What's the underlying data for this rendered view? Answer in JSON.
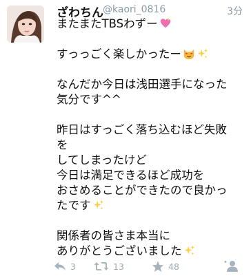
{
  "user": {
    "display_name": "ざわちん",
    "handle": "@kaori_0816",
    "time": "3分"
  },
  "tweet": {
    "lines": [
      "またまたTBSわずー",
      "",
      "すっっごく楽しかったー",
      "",
      "なんだか今日は浅田選手になった",
      "気分です^^",
      "",
      "昨日はすっごく落ち込むほど失敗",
      "を",
      "してしまったけど",
      "今日は満足できるほど成功を",
      "おさめることができたので良かっ",
      "たです",
      "",
      "関係者の皆さま本当に",
      "ありがとうございました"
    ]
  },
  "actions": {
    "reply_count": "3",
    "retweet_count": "13",
    "favorite_count": "48"
  },
  "icons": {
    "reply": "reply-icon",
    "retweet": "retweet-icon",
    "favorite": "star-icon",
    "more": "follow-icon",
    "heart_emoji": "sparkling-heart-emoji",
    "cat_emoji": "heart-eyes-cat-emoji",
    "sparkles_emoji": "sparkles-emoji"
  },
  "colors": {
    "meta_gray": "#8899a6",
    "action_gray": "#9aa8b3",
    "text": "#111111"
  }
}
